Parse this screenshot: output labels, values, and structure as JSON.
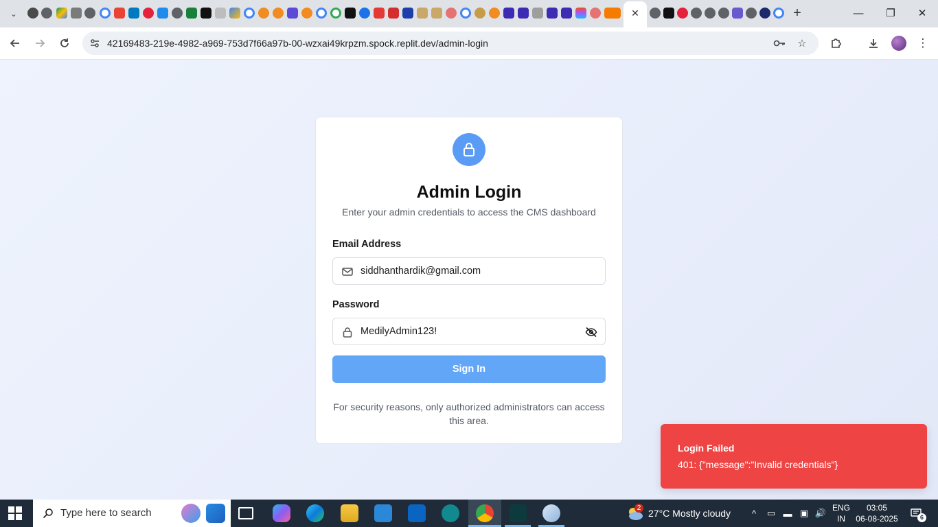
{
  "browser": {
    "url": "42169483-219e-4982-a969-753d7f66a97b-00-wzxai49krpzm.spock.replit.dev/admin-login",
    "tab_close_glyph": "✕",
    "new_tab_glyph": "+",
    "window": {
      "minimize": "—",
      "restore": "❐",
      "close": "✕"
    },
    "toolbar_icons": {
      "back": "back-icon",
      "forward": "forward-icon",
      "reload": "reload-icon",
      "site_info": "tune-icon",
      "password": "key-icon",
      "bookmark": "star-icon",
      "extensions": "puzzle-icon",
      "downloads": "download-icon",
      "menu": "kebab-menu-icon"
    }
  },
  "login": {
    "title": "Admin Login",
    "subtitle": "Enter your admin credentials to access the CMS dashboard",
    "email_label": "Email Address",
    "email_value": "siddhanthardik@gmail.com",
    "password_label": "Password",
    "password_value": "MedilyAdmin123!",
    "submit_label": "Sign In",
    "note": "For security reasons, only authorized administrators can access this area.",
    "accent_color": "#5a9cf5"
  },
  "toast": {
    "title": "Login Failed",
    "message": "401: {\"message\":\"Invalid credentials\"}",
    "color": "#ef4444"
  },
  "taskbar": {
    "search_placeholder": "Type here to search",
    "weather_badge": "2",
    "weather": "27°C  Mostly cloudy",
    "lang_line1": "ENG",
    "lang_line2": "IN",
    "time": "03:05",
    "date": "06-08-2025",
    "notifications": "6"
  }
}
